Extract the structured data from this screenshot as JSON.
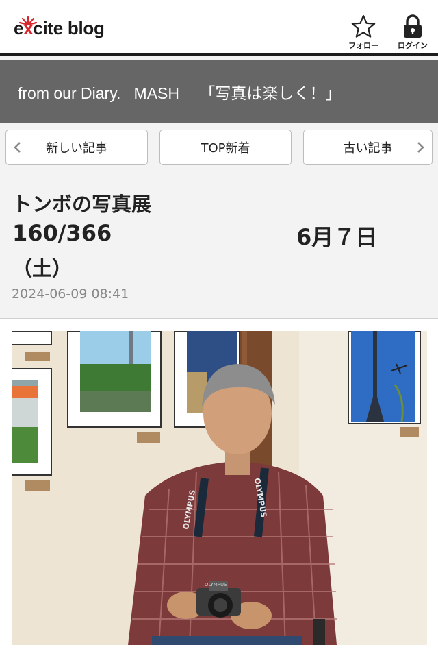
{
  "header": {
    "logo_text_prefix": "e",
    "logo_text_x": "x",
    "logo_text_suffix": "cite blog",
    "follow_label": "フォロー",
    "login_label": "ログイン"
  },
  "blog": {
    "title": "from our Diary.   MASH　 「写真は楽しく！」"
  },
  "nav": {
    "prev_label": "新しい記事",
    "top_label": "TOP新着",
    "next_label": "古い記事"
  },
  "post": {
    "title_line1": "トンボの写真展",
    "title_line2": "160/366",
    "title_date": "6月７日",
    "title_line3": "（土）",
    "date": "2024-06-09 08:41"
  },
  "photo": {
    "strap_text": "OLYMPUS",
    "camera_text": "OLYMPUS"
  },
  "icons": {
    "follow": "star-icon",
    "login": "lock-icon",
    "prev": "chevron-left-icon",
    "next": "chevron-right-icon"
  },
  "colors": {
    "title_band": "#666666",
    "logo_accent": "#d8262d"
  }
}
